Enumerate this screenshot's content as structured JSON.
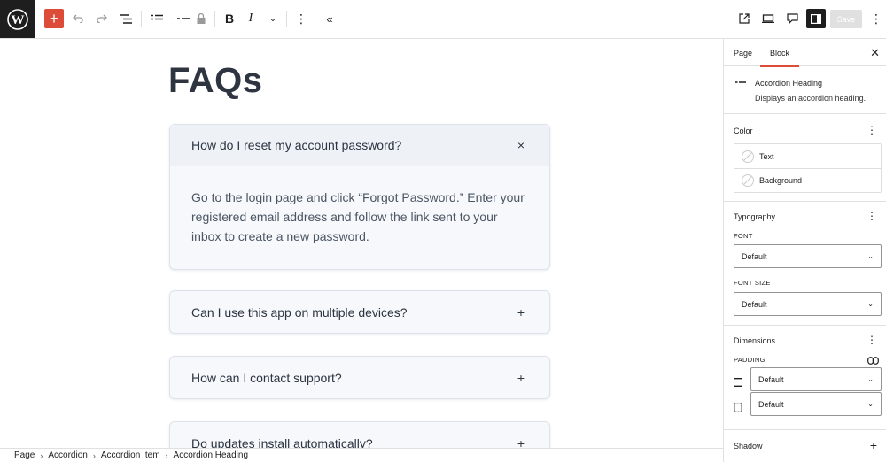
{
  "toolbar": {
    "save_label": "Save",
    "icons": [
      "wordpress-logo",
      "plus-icon",
      "undo-icon",
      "redo-icon",
      "document-overview-icon",
      "list-view-icon",
      "more-icon",
      "lock-icon",
      "bold-icon",
      "italic-icon",
      "chevron-down-icon",
      "options-icon",
      "collapse-icon",
      "external-view-icon",
      "device-preview-icon",
      "comment-icon",
      "settings-icon",
      "options-icon"
    ],
    "colors": {
      "inserter": "#dd4b39",
      "dark": "#1e1e1e"
    }
  },
  "canvas": {
    "title": "FAQs",
    "accordion": [
      {
        "heading": "How do I reset my account password?",
        "icon": "×",
        "expanded": true,
        "body": "Go to the login page and click “Forgot Password.” Enter your registered email address and follow the link sent to your inbox to create a new password."
      },
      {
        "heading": "Can I use this app on multiple devices?",
        "icon": "+",
        "expanded": false
      },
      {
        "heading": "How can I contact support?",
        "icon": "+",
        "expanded": false
      },
      {
        "heading": "Do updates install automatically?",
        "icon": "+",
        "expanded": false
      }
    ]
  },
  "breadcrumbs": [
    "Page",
    "Accordion",
    "Accordion Item",
    "Accordion Heading"
  ],
  "sidebar": {
    "tabs": [
      "Page",
      "Block"
    ],
    "active_tab": "Block",
    "block": {
      "name": "Accordion Heading",
      "description": "Displays an accordion heading."
    },
    "color": {
      "title": "Color",
      "items": [
        "Text",
        "Background"
      ]
    },
    "typography": {
      "title": "Typography",
      "font_label": "FONT",
      "font_value": "Default",
      "font_size_label": "FONT SIZE",
      "font_size_value": "Default"
    },
    "dimensions": {
      "title": "Dimensions",
      "padding_label": "PADDING",
      "vertical_value": "Default",
      "horizontal_value": "Default"
    },
    "shadow": {
      "title": "Shadow"
    }
  }
}
